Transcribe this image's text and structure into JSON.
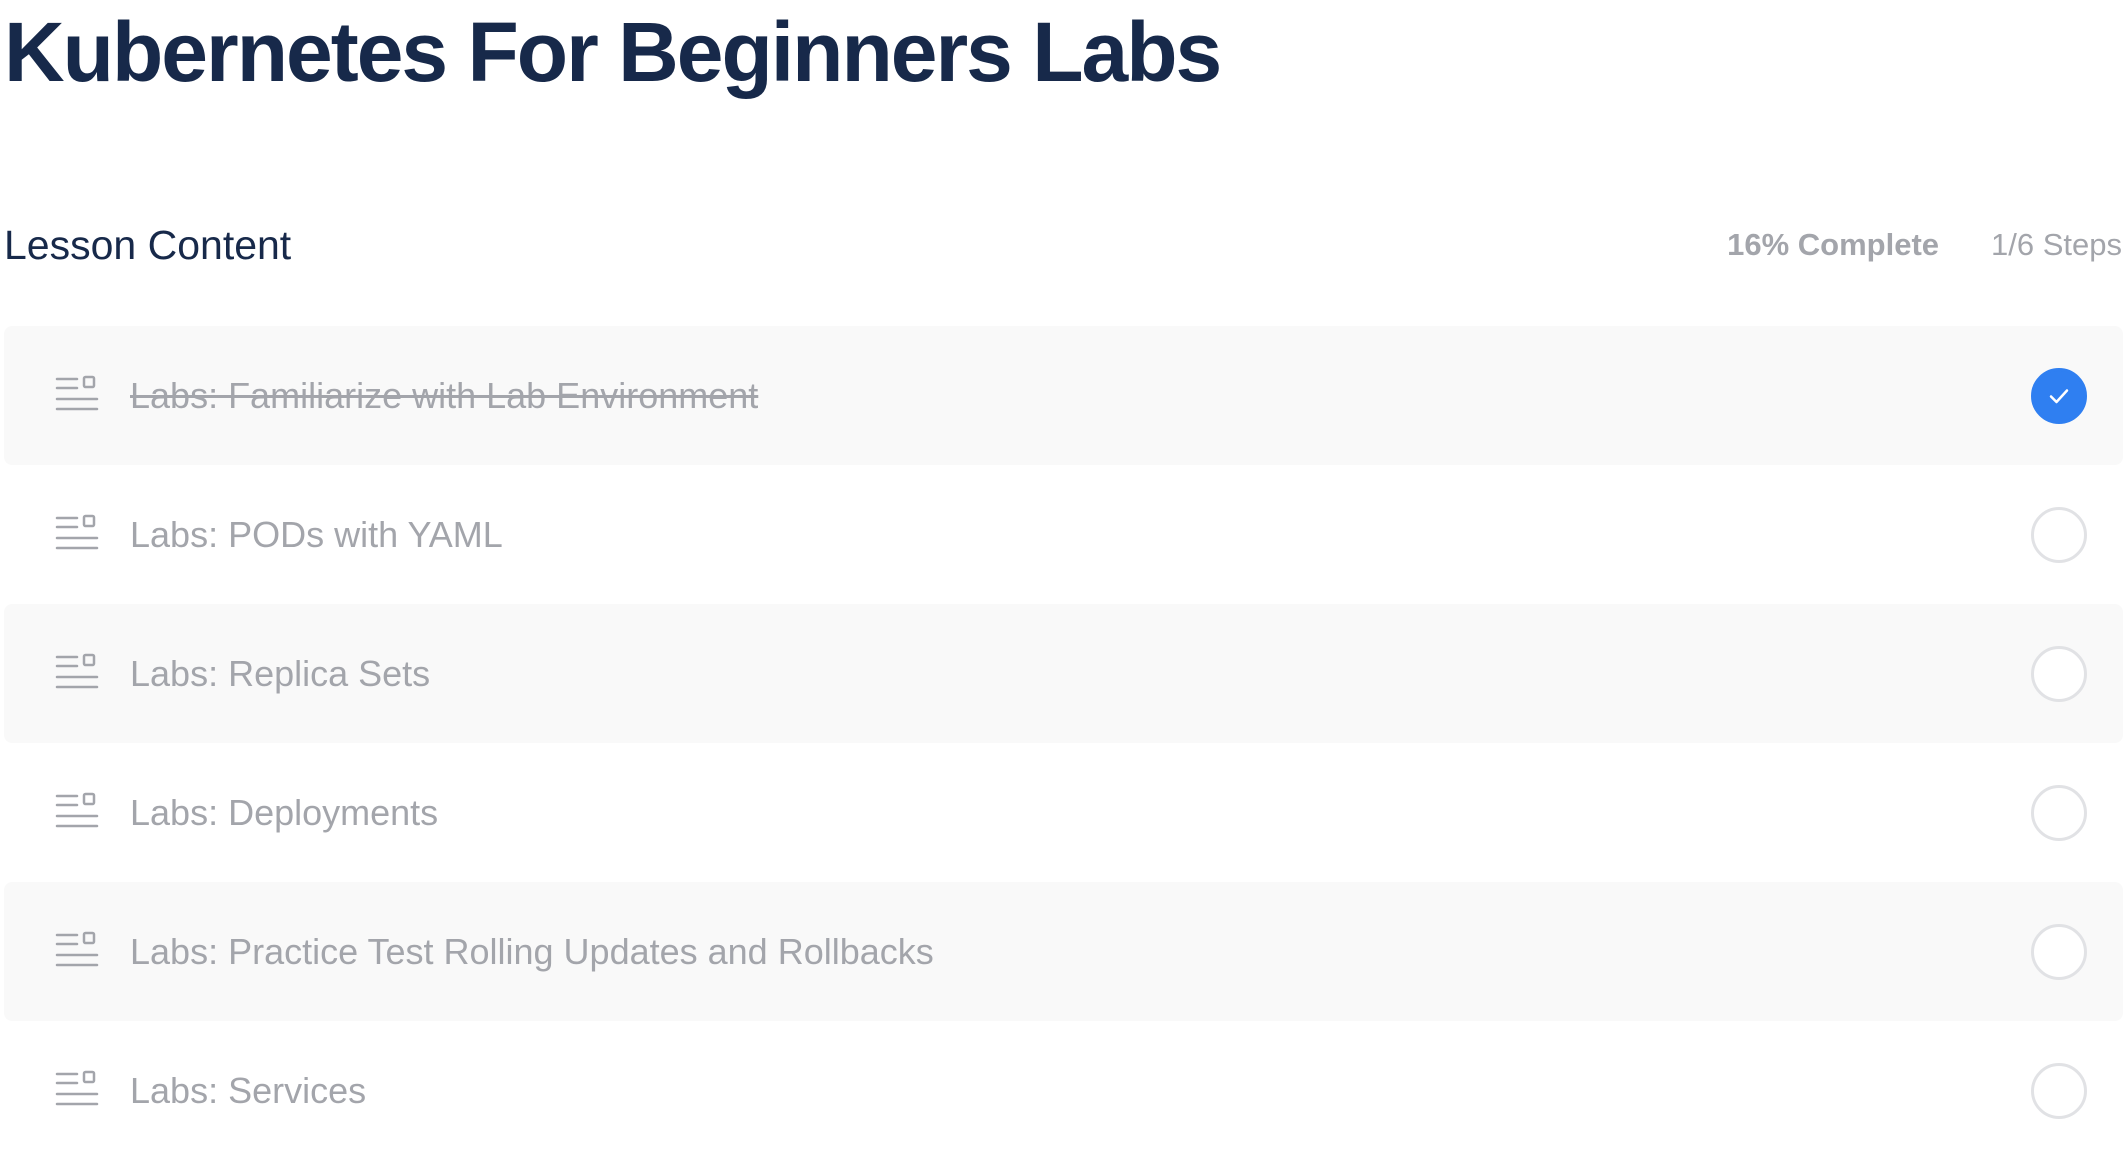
{
  "course": {
    "title": "Kubernetes For Beginners Labs"
  },
  "lesson_content": {
    "heading": "Lesson Content",
    "percent_complete": "16% Complete",
    "steps": "1/6 Steps"
  },
  "colors": {
    "title_text": "#17294a",
    "muted_text": "#a3a5ab",
    "row_shade": "#f9f9f9",
    "complete_accent": "#2f7ff1",
    "circle_border": "#e1e2e5"
  },
  "lessons": [
    {
      "label": "Labs: Familiarize with Lab Environment",
      "completed": true,
      "icon": "lesson-text-icon"
    },
    {
      "label": "Labs: PODs with YAML",
      "completed": false,
      "icon": "lesson-text-icon"
    },
    {
      "label": "Labs: Replica Sets",
      "completed": false,
      "icon": "lesson-text-icon"
    },
    {
      "label": "Labs: Deployments",
      "completed": false,
      "icon": "lesson-text-icon"
    },
    {
      "label": "Labs: Practice Test Rolling Updates and Rollbacks",
      "completed": false,
      "icon": "lesson-text-icon"
    },
    {
      "label": "Labs: Services",
      "completed": false,
      "icon": "lesson-text-icon"
    }
  ]
}
